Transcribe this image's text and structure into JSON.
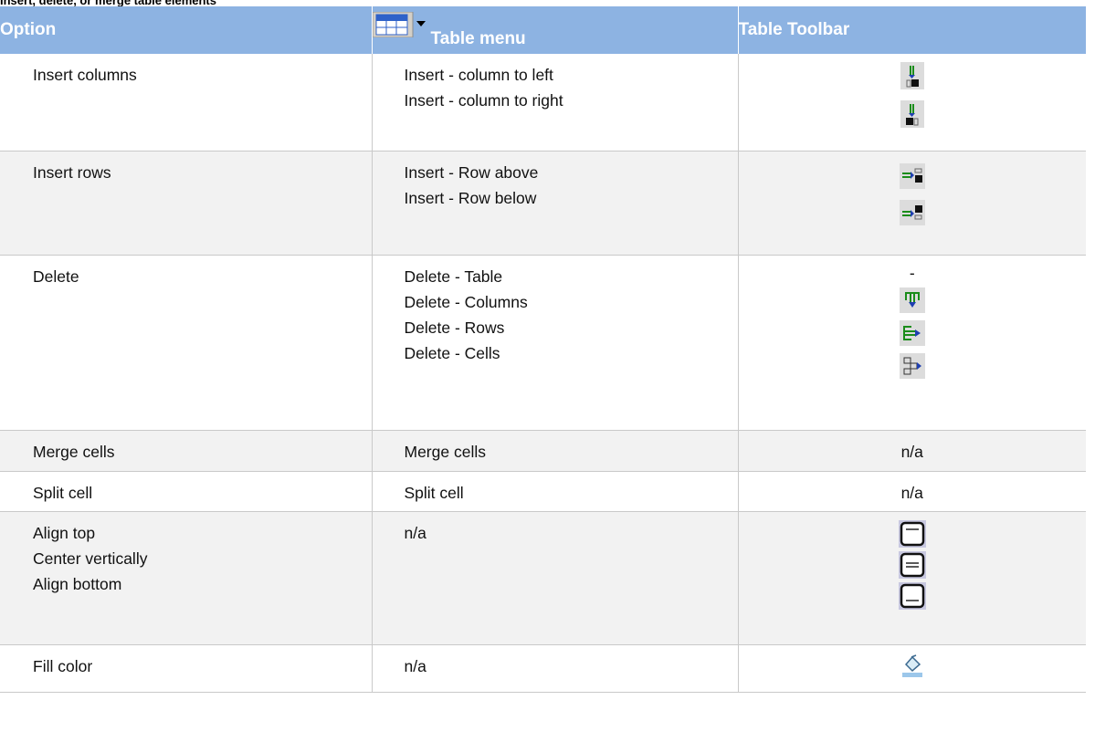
{
  "caption": "Insert, delete, or merge table elements",
  "header": {
    "option": "Option",
    "table_menu": "Table menu",
    "table_toolbar": "Table Toolbar"
  },
  "rows": [
    {
      "option": [
        "Insert columns"
      ],
      "menu": [
        "Insert - column to left",
        "Insert - column to right"
      ],
      "toolbar": [
        "insert-column-left-icon",
        "insert-column-right-icon"
      ]
    },
    {
      "option": [
        "Insert rows"
      ],
      "menu": [
        "Insert - Row above",
        "Insert - Row below"
      ],
      "toolbar": [
        "insert-row-above-icon",
        "insert-row-below-icon"
      ]
    },
    {
      "option": [
        "Delete"
      ],
      "menu": [
        "Delete - Table",
        "Delete - Columns",
        "Delete - Rows",
        "Delete - Cells"
      ],
      "toolbar": [
        "-",
        "delete-columns-icon",
        "delete-rows-icon",
        "delete-cells-icon"
      ]
    },
    {
      "option": [
        "Merge cells"
      ],
      "menu": [
        "Merge cells"
      ],
      "toolbar": [
        "n/a"
      ]
    },
    {
      "option": [
        "Split cell"
      ],
      "menu": [
        "Split cell"
      ],
      "toolbar": [
        "n/a"
      ]
    },
    {
      "option": [
        "Align top",
        "Center vertically",
        "Align bottom"
      ],
      "menu": [
        "n/a"
      ],
      "toolbar": [
        "align-top-icon",
        "center-vertically-icon",
        "align-bottom-icon"
      ]
    },
    {
      "option": [
        "Fill color"
      ],
      "menu": [
        "n/a"
      ],
      "toolbar": [
        "fill-color-icon"
      ]
    }
  ],
  "colors": {
    "header_bg": "#8db3e2",
    "header_text": "#ffffff",
    "alt_row_bg": "#f2f2f2"
  }
}
